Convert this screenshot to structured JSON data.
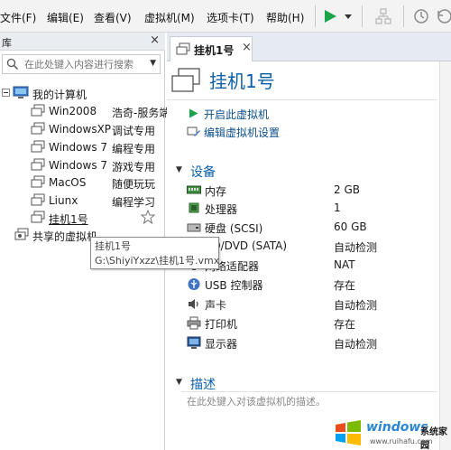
{
  "menu": {
    "items": [
      "文件(F)",
      "编辑(E)",
      "查看(V)",
      "虚拟机(M)",
      "选项卡(T)",
      "帮助(H)"
    ],
    "accent": "#1aa34a"
  },
  "library": {
    "title": "库",
    "search_placeholder": "在此处键入内容进行搜索",
    "root_label": "我的计算机",
    "vms": [
      {
        "name": "Win2008",
        "desc": "浩奇-服务端"
      },
      {
        "name": "WindowsXP",
        "desc": "调试专用"
      },
      {
        "name": "Windows 7",
        "desc": "编程专用"
      },
      {
        "name": "Windows 7",
        "desc": "游戏专用"
      },
      {
        "name": "MacOS",
        "desc": "随便玩玩"
      },
      {
        "name": "Liunx",
        "desc": "编程学习"
      },
      {
        "name": "挂机1号",
        "desc": ""
      }
    ],
    "shared_label": "共享的虚拟机"
  },
  "tooltip": {
    "line1": "挂机1号",
    "line2": "G:\\ShiyiYxzz\\挂机1号.vmx"
  },
  "tab": {
    "label": "挂机1号"
  },
  "vm": {
    "title": "挂机1号",
    "actions": [
      "开启此虚拟机",
      "编辑虚拟机设置"
    ],
    "devices_header": "设备",
    "devices": [
      {
        "icon": "memory-icon",
        "name": "内存",
        "value": "2 GB"
      },
      {
        "icon": "cpu-icon",
        "name": "处理器",
        "value": "1"
      },
      {
        "icon": "hdd-icon",
        "name": "硬盘 (SCSI)",
        "value": "60 GB"
      },
      {
        "icon": "cd-icon",
        "name": "CD/DVD (SATA)",
        "value": "自动检测"
      },
      {
        "icon": "network-icon",
        "name": "网络适配器",
        "value": "NAT"
      },
      {
        "icon": "usb-icon",
        "name": "USB 控制器",
        "value": "存在"
      },
      {
        "icon": "sound-icon",
        "name": "声卡",
        "value": "自动检测"
      },
      {
        "icon": "printer-icon",
        "name": "打印机",
        "value": "存在"
      },
      {
        "icon": "display-icon",
        "name": "显示器",
        "value": "自动检测"
      }
    ],
    "desc_header": "描述",
    "desc_placeholder": "在此处键入对该虚拟机的描述。"
  },
  "watermark": {
    "brand": "windows",
    "brand_cn": "系统家园",
    "url": "www.ruihafu.com"
  }
}
